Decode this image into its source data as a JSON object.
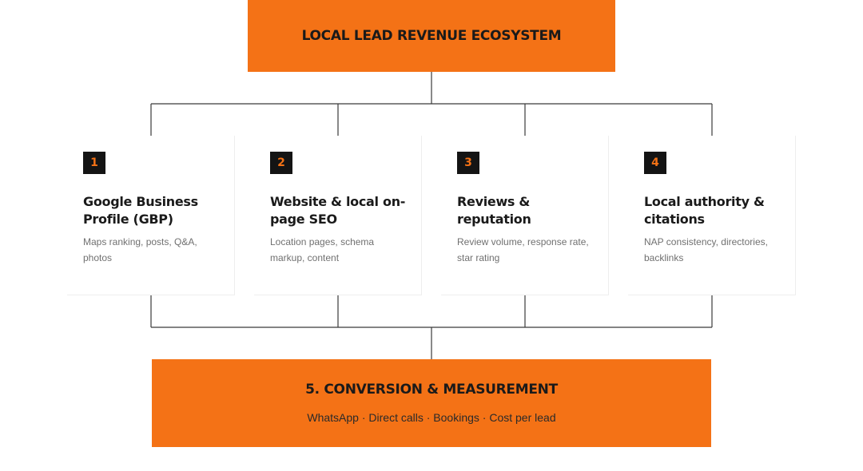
{
  "ecosystem": {
    "title": "LOCAL LEAD REVENUE ECOSYSTEM"
  },
  "pillars": [
    {
      "number": "1",
      "title": "Google Business Profile (GBP)",
      "description": "Maps ranking, posts, Q&A, photos"
    },
    {
      "number": "2",
      "title": "Website & local on-page SEO",
      "description": "Location pages, schema markup, content"
    },
    {
      "number": "3",
      "title": "Reviews & reputation",
      "description": "Review volume, response rate, star rating"
    },
    {
      "number": "4",
      "title": "Local authority & citations",
      "description": "NAP consistency, directories, backlinks"
    }
  ],
  "conversion": {
    "title": "5. CONVERSION & MEASUREMENT",
    "subtitle": "WhatsApp · Direct calls · Bookings · Cost per lead"
  },
  "colors": {
    "accent": "#f47216",
    "badge_bg": "#141414",
    "connector": "#3a3a3a",
    "text": "#1a1a1a",
    "muted": "#707070"
  }
}
